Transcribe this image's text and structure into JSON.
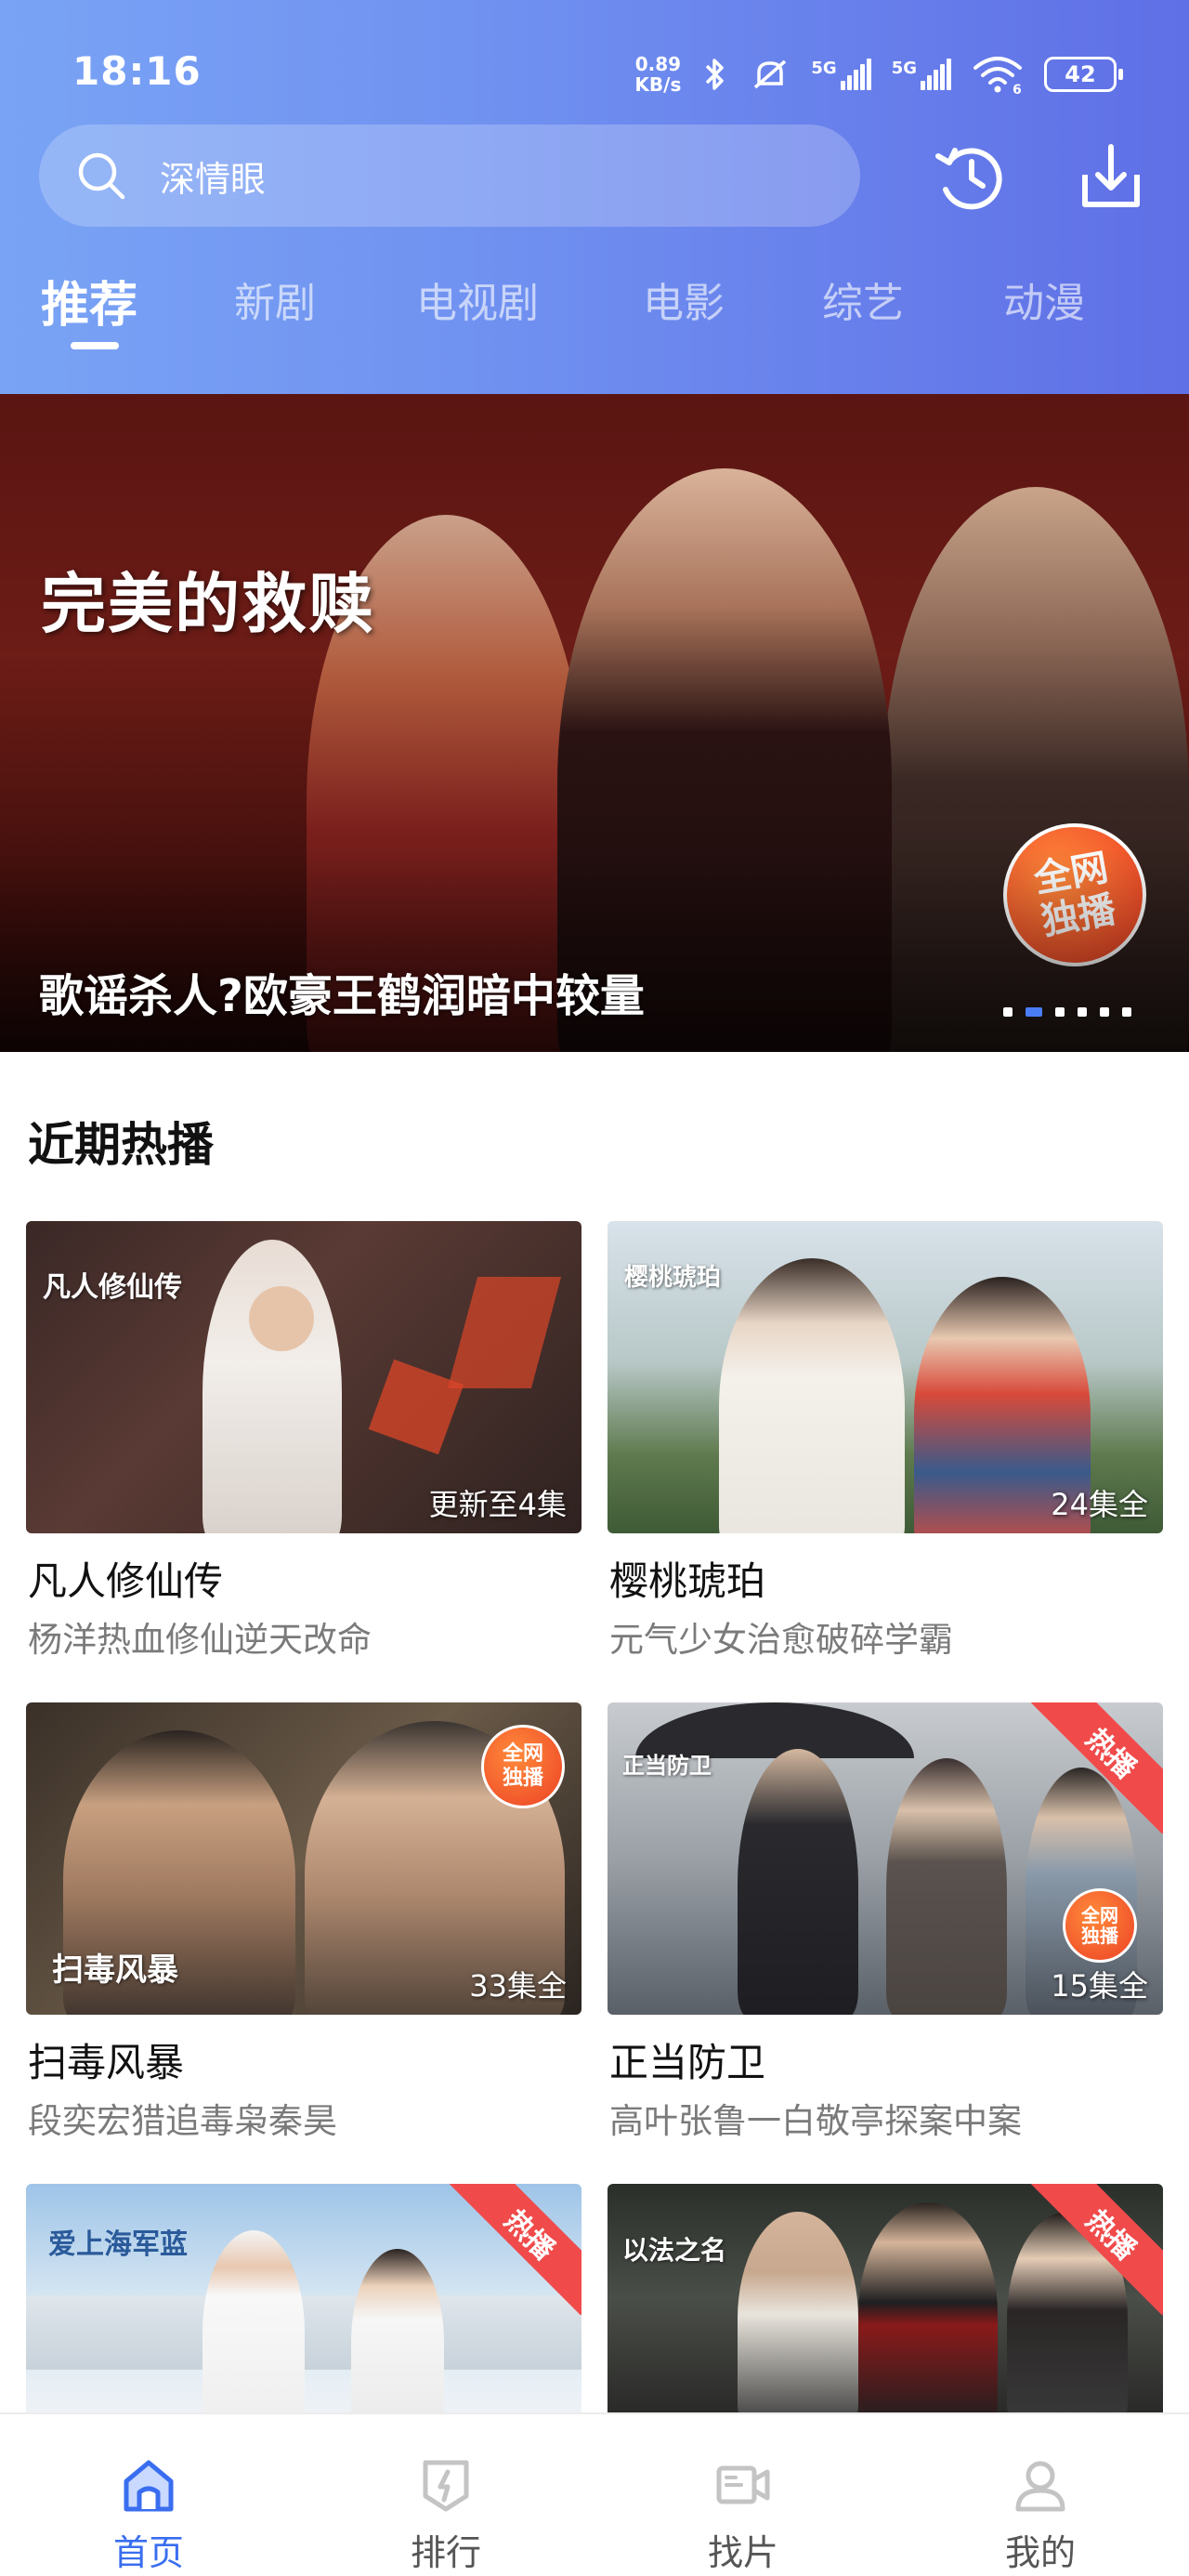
{
  "status_bar": {
    "time": "18:16",
    "net_speed_value": "0.89",
    "net_speed_unit": "KB/s",
    "signal1_tag": "5G",
    "signal2_tag": "5G",
    "wifi_tag": "6",
    "battery": "42"
  },
  "search": {
    "text": "深情眼",
    "icon": "search-icon"
  },
  "header_icons": [
    "history-icon",
    "download-icon"
  ],
  "tabs": [
    {
      "label": "推荐",
      "active": true
    },
    {
      "label": "新剧",
      "active": false
    },
    {
      "label": "电视剧",
      "active": false
    },
    {
      "label": "电影",
      "active": false
    },
    {
      "label": "综艺",
      "active": false
    },
    {
      "label": "动漫",
      "active": false
    }
  ],
  "banner": {
    "logo_text": "完美的救赎",
    "badge_line1": "全网",
    "badge_line2": "独播",
    "caption": "歌谣杀人?欧豪王鹤润暗中较量",
    "total_slides": 6,
    "active_slide": 2
  },
  "section": {
    "title": "近期热播"
  },
  "cards": [
    {
      "title": "凡人修仙传",
      "subtitle": "杨洋热血修仙逆天改命",
      "episodes": "更新至4集",
      "logo": "凡人修仙传",
      "hot": false
    },
    {
      "title": "樱桃琥珀",
      "subtitle": "元气少女治愈破碎学霸",
      "episodes": "24集全",
      "logo": "樱桃琥珀",
      "hot": false
    },
    {
      "title": "扫毒风暴",
      "subtitle": "段奕宏猎追毒枭秦昊",
      "episodes": "33集全",
      "logo": "扫毒风暴",
      "badge_line1": "全网",
      "badge_line2": "独播",
      "hot": false
    },
    {
      "title": "正当防卫",
      "subtitle": "高叶张鲁一白敬亭探案中案",
      "episodes": "15集全",
      "logo": "正当防卫",
      "badge_line1": "全网",
      "badge_line2": "独播",
      "hot": true,
      "hot_label": "热播"
    },
    {
      "title": "",
      "subtitle": "",
      "episodes": "",
      "logo": "爱上海军蓝",
      "hot": true,
      "hot_label": "热播"
    },
    {
      "title": "",
      "subtitle": "",
      "episodes": "",
      "logo": "以法之名",
      "hot": true,
      "hot_label": "热播"
    }
  ],
  "bottom_nav": [
    {
      "label": "首页",
      "icon": "home-icon",
      "active": true
    },
    {
      "label": "排行",
      "icon": "ranking-icon",
      "active": false
    },
    {
      "label": "找片",
      "icon": "video-search-icon",
      "active": false
    },
    {
      "label": "我的",
      "icon": "profile-icon",
      "active": false
    }
  ],
  "colors": {
    "header_start": "#79a4f5",
    "header_end": "#5f6fe6",
    "accent": "#3a6ef0",
    "hot_ribbon": "#f04a4a",
    "badge_orange": "#f0502a"
  }
}
